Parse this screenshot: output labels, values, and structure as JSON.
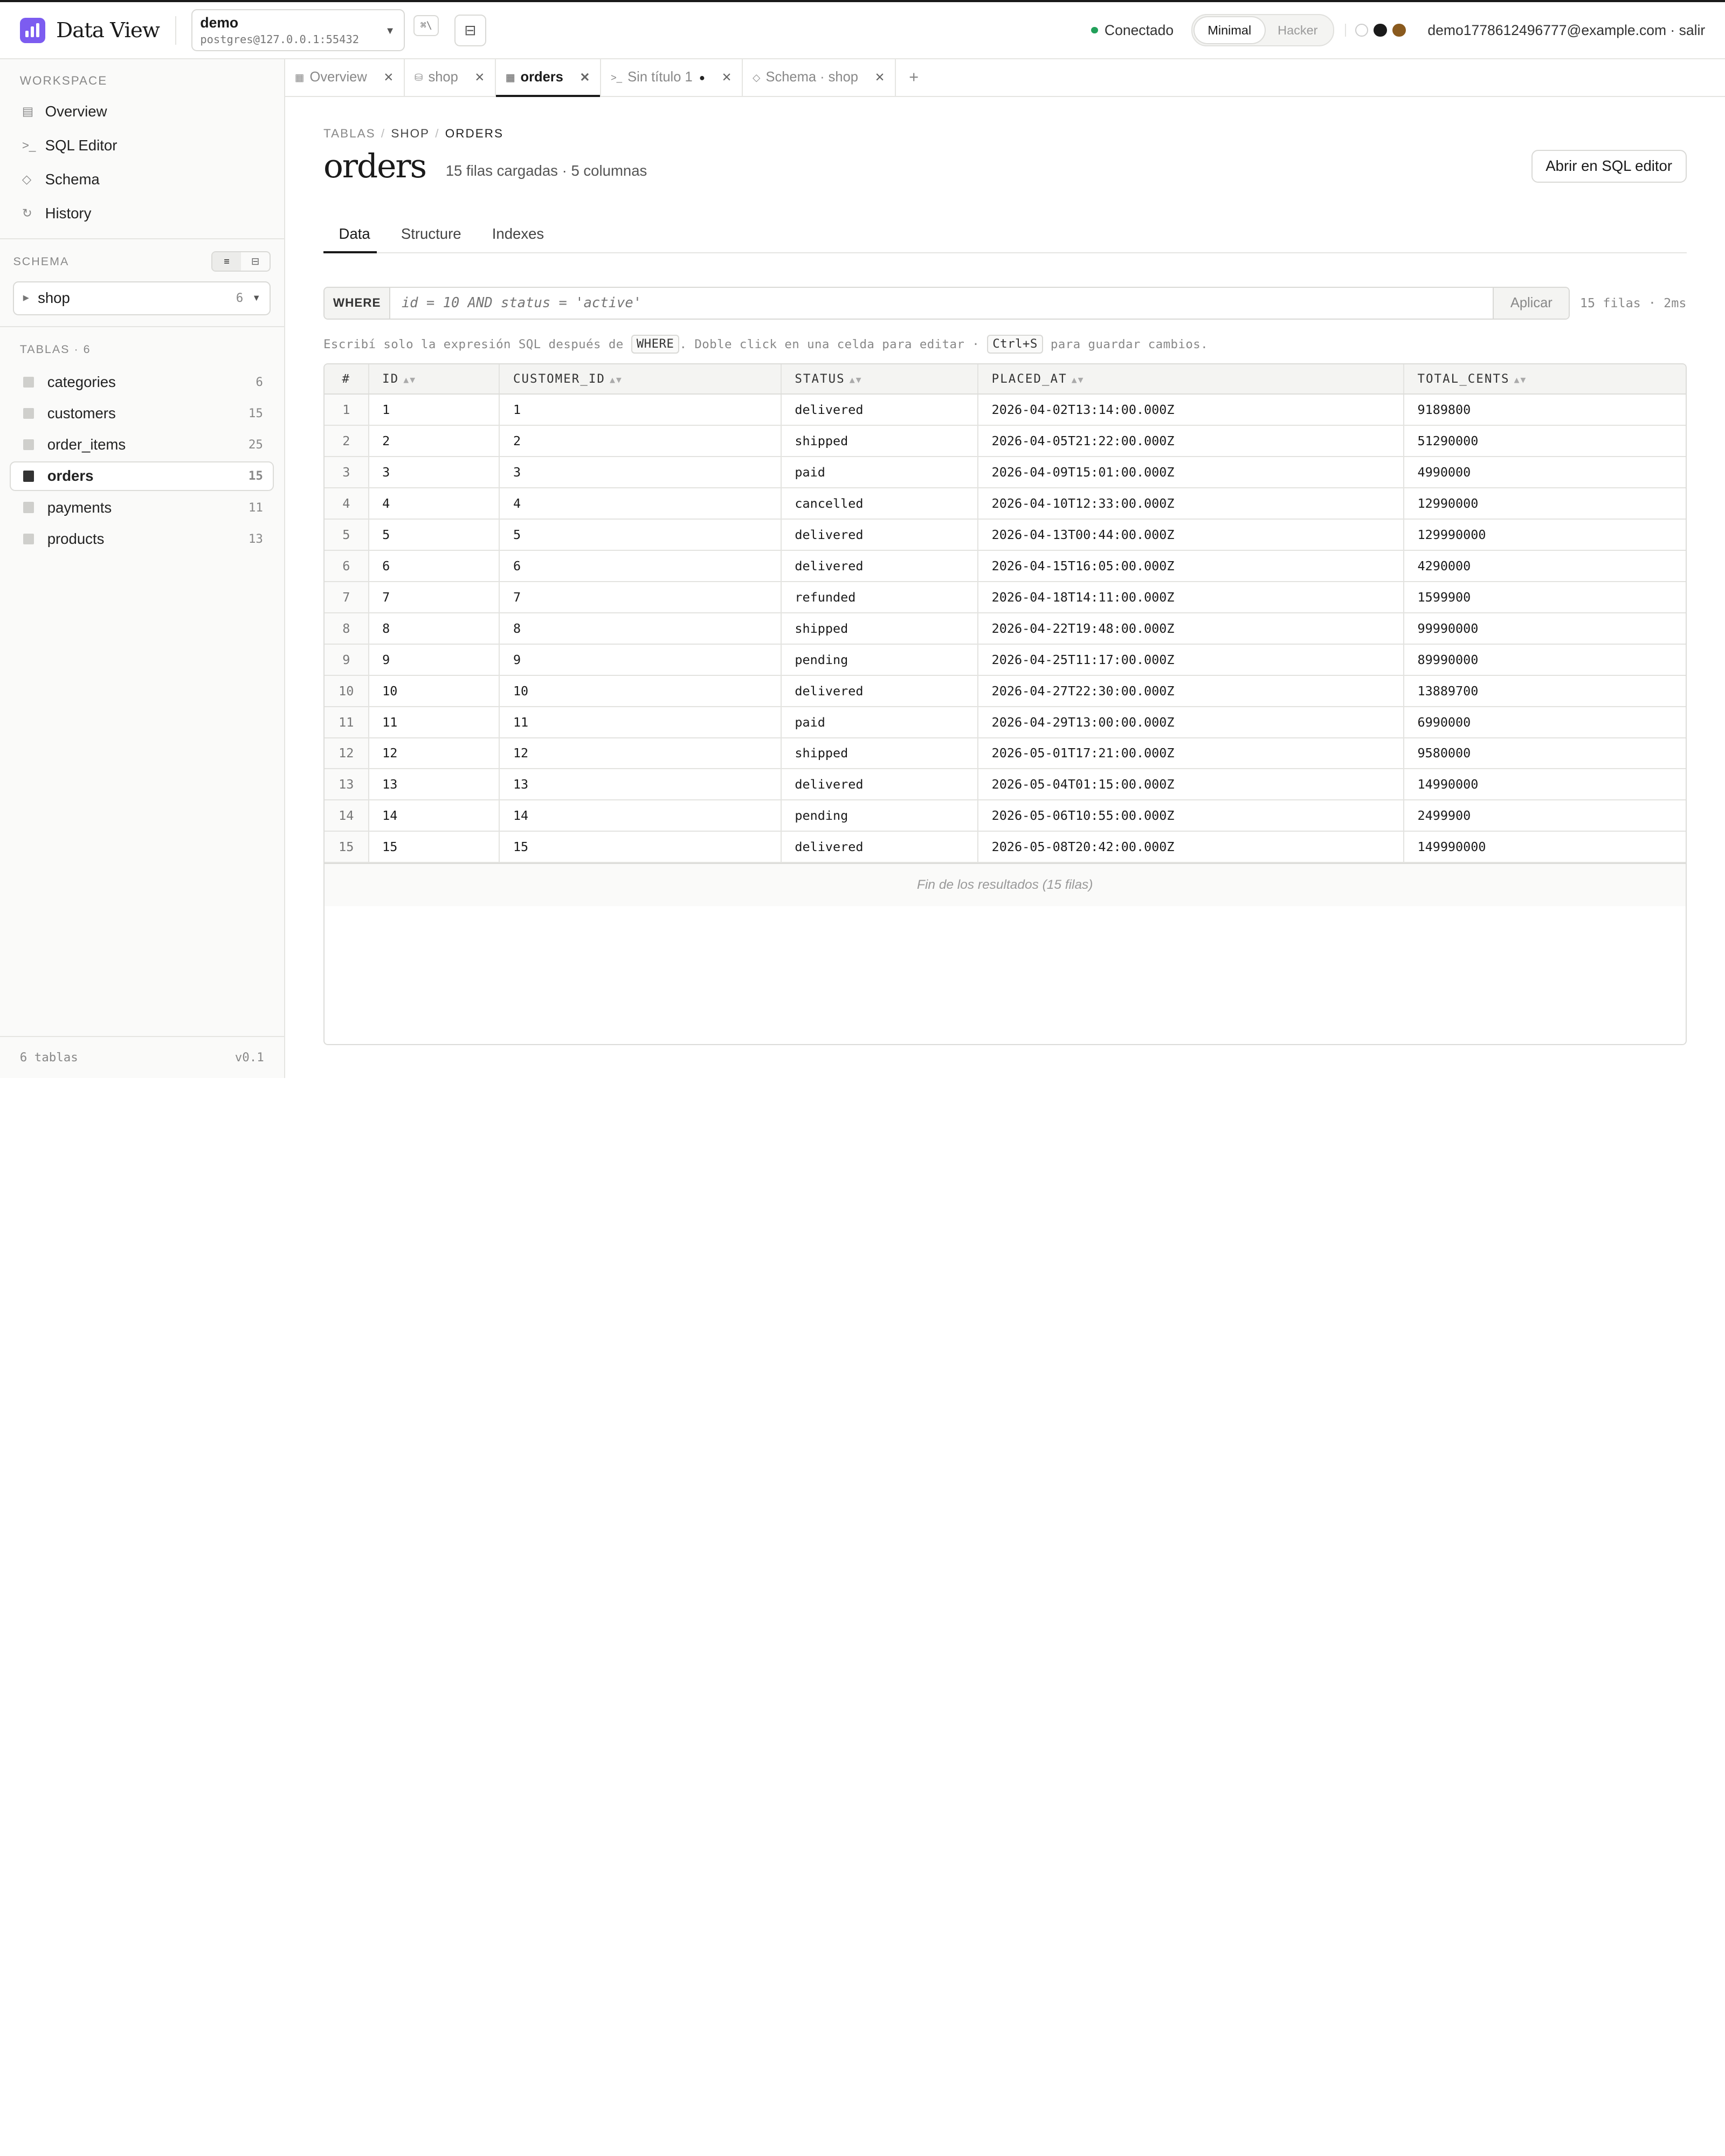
{
  "app": {
    "title": "Data View"
  },
  "connection": {
    "name": "demo",
    "url": "postgres@127.0.0.1:55432"
  },
  "shortcut_hint": "⌘\\",
  "status": {
    "text": "Conectado",
    "color": "#22a05a"
  },
  "theme": {
    "options": [
      "Minimal",
      "Hacker"
    ],
    "selected": "Minimal"
  },
  "swatches": [
    "#ffffff",
    "#1a1a1a",
    "#8a5a1e"
  ],
  "user": {
    "email_logout": "demo1778612496777@example.com · salir"
  },
  "sidebar": {
    "workspace_label": "WORKSPACE",
    "nav": [
      {
        "icon": "▤",
        "label": "Overview"
      },
      {
        "icon": ">_",
        "label": "SQL Editor"
      },
      {
        "icon": "◇",
        "label": "Schema"
      },
      {
        "icon": "↻",
        "label": "History"
      }
    ],
    "schema_label": "SCHEMA",
    "schema": {
      "name": "shop",
      "count": "6"
    },
    "tables_label": "TABLAS · 6",
    "tables": [
      {
        "name": "categories",
        "count": "6"
      },
      {
        "name": "customers",
        "count": "15"
      },
      {
        "name": "order_items",
        "count": "25"
      },
      {
        "name": "orders",
        "count": "15",
        "active": true
      },
      {
        "name": "payments",
        "count": "11"
      },
      {
        "name": "products",
        "count": "13"
      }
    ],
    "footer_left": "6 tablas",
    "footer_right": "v0.1"
  },
  "tabs": [
    {
      "icon": "▦",
      "label": "Overview"
    },
    {
      "icon": "⛁",
      "label": "shop"
    },
    {
      "icon": "▦",
      "label": "orders",
      "active": true
    },
    {
      "icon": ">_",
      "label": "Sin título 1",
      "dirty": "●"
    },
    {
      "icon": "◇",
      "label": "Schema · shop"
    }
  ],
  "tab_add": "+",
  "page": {
    "breadcrumb": [
      "TABLAS",
      "SHOP",
      "ORDERS"
    ],
    "title": "orders",
    "subtitle": "15 filas cargadas · 5 columnas",
    "open_sql_label": "Abrir en SQL editor",
    "subtabs": [
      "Data",
      "Structure",
      "Indexes"
    ],
    "active_subtab": "Data"
  },
  "filter": {
    "keyword": "WHERE",
    "placeholder": "id = 10 AND status = 'active'",
    "apply_label": "Aplicar",
    "meta": "15 filas · 2ms"
  },
  "hint": {
    "part1": "Escribí solo la expresión SQL después de ",
    "kw": "WHERE",
    "part2": ". Doble click en una celda para editar · ",
    "key": "Ctrl+S",
    "part3": " para guardar cambios."
  },
  "grid": {
    "columns": [
      "#",
      "ID",
      "CUSTOMER_ID",
      "STATUS",
      "PLACED_AT",
      "TOTAL_CENTS"
    ],
    "rows": [
      [
        "1",
        "1",
        "1",
        "delivered",
        "2026-04-02T13:14:00.000Z",
        "9189800"
      ],
      [
        "2",
        "2",
        "2",
        "shipped",
        "2026-04-05T21:22:00.000Z",
        "51290000"
      ],
      [
        "3",
        "3",
        "3",
        "paid",
        "2026-04-09T15:01:00.000Z",
        "4990000"
      ],
      [
        "4",
        "4",
        "4",
        "cancelled",
        "2026-04-10T12:33:00.000Z",
        "12990000"
      ],
      [
        "5",
        "5",
        "5",
        "delivered",
        "2026-04-13T00:44:00.000Z",
        "129990000"
      ],
      [
        "6",
        "6",
        "6",
        "delivered",
        "2026-04-15T16:05:00.000Z",
        "4290000"
      ],
      [
        "7",
        "7",
        "7",
        "refunded",
        "2026-04-18T14:11:00.000Z",
        "1599900"
      ],
      [
        "8",
        "8",
        "8",
        "shipped",
        "2026-04-22T19:48:00.000Z",
        "99990000"
      ],
      [
        "9",
        "9",
        "9",
        "pending",
        "2026-04-25T11:17:00.000Z",
        "89990000"
      ],
      [
        "10",
        "10",
        "10",
        "delivered",
        "2026-04-27T22:30:00.000Z",
        "13889700"
      ],
      [
        "11",
        "11",
        "11",
        "paid",
        "2026-04-29T13:00:00.000Z",
        "6990000"
      ],
      [
        "12",
        "12",
        "12",
        "shipped",
        "2026-05-01T17:21:00.000Z",
        "9580000"
      ],
      [
        "13",
        "13",
        "13",
        "delivered",
        "2026-05-04T01:15:00.000Z",
        "14990000"
      ],
      [
        "14",
        "14",
        "14",
        "pending",
        "2026-05-06T10:55:00.000Z",
        "2499900"
      ],
      [
        "15",
        "15",
        "15",
        "delivered",
        "2026-05-08T20:42:00.000Z",
        "149990000"
      ]
    ],
    "end_text": "Fin de los resultados (15 filas)"
  }
}
